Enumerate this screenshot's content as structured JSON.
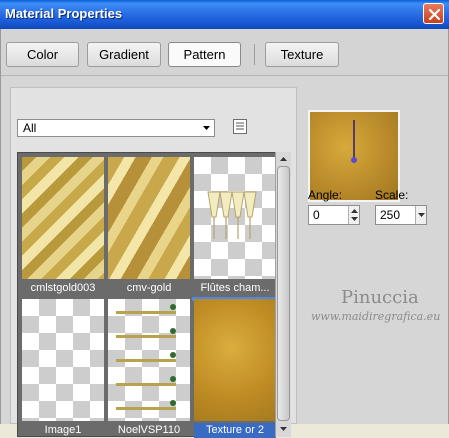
{
  "window": {
    "title": "Material Properties"
  },
  "tabs": [
    {
      "label": "Color"
    },
    {
      "label": "Gradient"
    },
    {
      "label": "Pattern"
    },
    {
      "label": "Texture"
    }
  ],
  "category": {
    "selected": "All"
  },
  "patterns": [
    {
      "name": "cmlstgold003"
    },
    {
      "name": "cmv-gold"
    },
    {
      "name": "Flûtes cham..."
    },
    {
      "name": "Image1"
    },
    {
      "name": "NoelVSP110"
    },
    {
      "name": "Texture or 2"
    }
  ],
  "angle": {
    "label": "Angle:",
    "value": "0"
  },
  "scale": {
    "label": "Scale:",
    "value": "250"
  },
  "watermark": {
    "name": "Pinuccia",
    "url": "www.maidiregrafica.eu"
  },
  "colors": {
    "selection": "#3a6bc2",
    "titlebar": "#1857d3"
  }
}
